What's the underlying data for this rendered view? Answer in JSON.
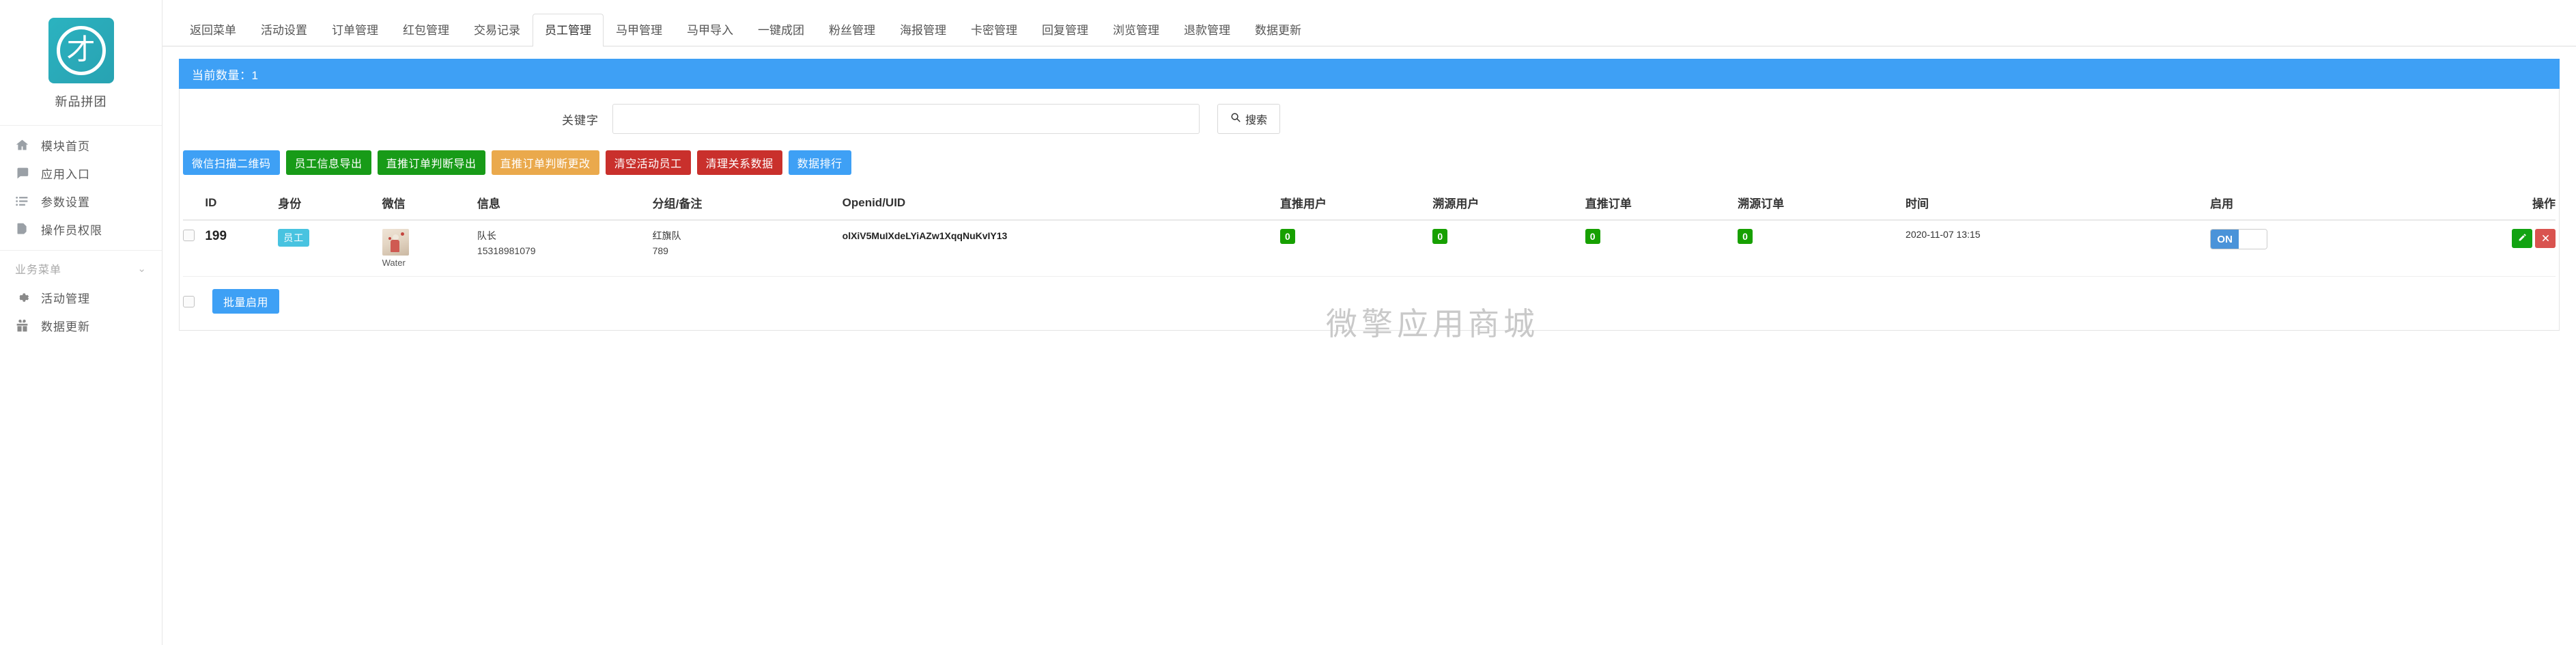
{
  "sidebar": {
    "brand": {
      "name": "新品拼团",
      "logo_glyph": "才",
      "logo_color": "#2bb3c0"
    },
    "primary_items": [
      {
        "label": "模块首页",
        "icon": "home-icon"
      },
      {
        "label": "应用入口",
        "icon": "chat-icon"
      },
      {
        "label": "参数设置",
        "icon": "list-icon"
      },
      {
        "label": "操作员权限",
        "icon": "document-edit-icon"
      }
    ],
    "group_title": "业务菜单",
    "group_items": [
      {
        "label": "活动管理",
        "icon": "gear-icon"
      },
      {
        "label": "数据更新",
        "icon": "gift-icon"
      }
    ]
  },
  "tabs": [
    {
      "label": "返回菜单",
      "active": false
    },
    {
      "label": "活动设置",
      "active": false
    },
    {
      "label": "订单管理",
      "active": false
    },
    {
      "label": "红包管理",
      "active": false
    },
    {
      "label": "交易记录",
      "active": false
    },
    {
      "label": "员工管理",
      "active": true
    },
    {
      "label": "马甲管理",
      "active": false
    },
    {
      "label": "马甲导入",
      "active": false
    },
    {
      "label": "一键成团",
      "active": false
    },
    {
      "label": "粉丝管理",
      "active": false
    },
    {
      "label": "海报管理",
      "active": false
    },
    {
      "label": "卡密管理",
      "active": false
    },
    {
      "label": "回复管理",
      "active": false
    },
    {
      "label": "浏览管理",
      "active": false
    },
    {
      "label": "退款管理",
      "active": false
    },
    {
      "label": "数据更新",
      "active": false
    }
  ],
  "alert": {
    "text": "当前数量：1",
    "bg": "#3ea0f5"
  },
  "search": {
    "label": "关键字",
    "value": "",
    "placeholder": "",
    "button_label": "搜索",
    "button_icon": "search-icon"
  },
  "action_buttons": [
    {
      "label": "微信扫描二维码",
      "color": "#3ea0f5"
    },
    {
      "label": "员工信息导出",
      "color": "#189b18"
    },
    {
      "label": "直推订单判断导出",
      "color": "#189b18"
    },
    {
      "label": "直推订单判断更改",
      "color": "#eaa council"
    },
    {
      "label": "清空活动员工",
      "color": "#c9302c"
    },
    {
      "label": "清理关系数据",
      "color": "#c9302c"
    },
    {
      "label": "数据排行",
      "color": "#3ea0f5"
    }
  ],
  "action_button_colors": {
    "wechat_scan": "#3ea0f5",
    "staff_export": "#189b18",
    "direct_order_export": "#189b18",
    "direct_order_change": "#eaa94c",
    "clear_staff": "#c9302c",
    "clear_relation": "#c9302c",
    "data_rank": "#3ea0f5"
  },
  "table": {
    "headers": [
      "ID",
      "身份",
      "微信",
      "信息",
      "分组/备注",
      "Openid/UID",
      "直推用户",
      "溯源用户",
      "直推订单",
      "溯源订单",
      "时间",
      "启用",
      "操作"
    ],
    "rows": [
      {
        "id": "199",
        "role_badge": "员工",
        "avatar_name": "Water",
        "info_line1": "队长",
        "info_line2": "15318981079",
        "group_line1": "红旗队",
        "group_line2": "789",
        "openid": "olXiV5MuIXdeLYiAZw1XqqNuKvIY13",
        "direct_users": "0",
        "trace_users": "0",
        "direct_orders": "0",
        "trace_orders": "0",
        "time": "2020-11-07 13:15",
        "enabled_label": "ON",
        "edit_icon": "edit-icon",
        "delete_icon": "close-icon"
      }
    ]
  },
  "footer": {
    "batch_button": "批量启用"
  },
  "watermark": "微擎应用商城"
}
